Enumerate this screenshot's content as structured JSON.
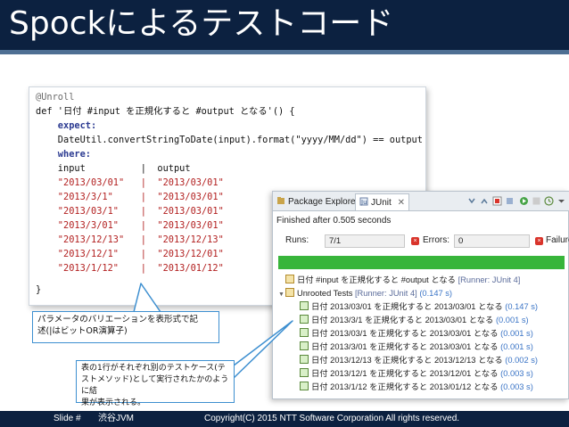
{
  "slide": {
    "title": "Spockによるテストコード"
  },
  "code": {
    "lines": [
      "@Unroll",
      "def '日付 #input を正規化すると #output となる'() {",
      "    expect:",
      "    DateUtil.convertStringToDate(input).format(\"yyyy/MM/dd\") == output",
      "    where:",
      "    input          |  output",
      "    \"2013/03/01\"   |  \"2013/03/01\"",
      "    \"2013/3/1\"     |  \"2013/03/01\"",
      "    \"2013/03/1\"    |  \"2013/03/01\"",
      "    \"2013/3/01\"    |  \"2013/03/01\"",
      "    \"2013/12/13\"   |  \"2013/12/13\"",
      "    \"2013/12/1\"    |  \"2013/12/01\"",
      "    \"2013/1/12\"    |  \"2013/01/12\"",
      "}"
    ]
  },
  "ide": {
    "tabs": [
      "Package Explorer",
      "JUnit"
    ],
    "status": "Finished after 0.505 seconds",
    "runs_label": "Runs:",
    "runs_value": "7/1",
    "errors_label": "Errors:",
    "errors_value": "0",
    "failures_label": "Failures",
    "progress_fraction": 1.0,
    "tree": [
      {
        "text": "日付 #input を正規化すると #output となる",
        "meta": "[Runner: JUnit 4]",
        "time": ""
      },
      {
        "text": "Unrooted Tests",
        "meta": "[Runner: JUnit 4]",
        "time": "(0.147 s)"
      },
      {
        "text": "日付 2013/03/01 を正規化すると 2013/03/01 となる",
        "meta": "",
        "time": "(0.147 s)"
      },
      {
        "text": "日付 2013/3/1 を正規化すると 2013/03/01 となる",
        "meta": "",
        "time": "(0.001 s)"
      },
      {
        "text": "日付 2013/03/1 を正規化すると 2013/03/01 となる",
        "meta": "",
        "time": "(0.001 s)"
      },
      {
        "text": "日付 2013/3/01 を正規化すると 2013/03/01 となる",
        "meta": "",
        "time": "(0.001 s)"
      },
      {
        "text": "日付 2013/12/13 を正規化すると 2013/12/13 となる",
        "meta": "",
        "time": "(0.002 s)"
      },
      {
        "text": "日付 2013/12/1 を正規化すると 2013/12/01 となる",
        "meta": "",
        "time": "(0.003 s)"
      },
      {
        "text": "日付 2013/1/12 を正規化すると 2013/01/12 となる",
        "meta": "",
        "time": "(0.003 s)"
      }
    ]
  },
  "callouts": {
    "first": [
      "パラメータのバリエーションを表形式で記",
      "述(|はビットOR演算子)"
    ],
    "second": [
      "表の1行がそれぞれ別のテストケース(テ",
      "ストメソッド)として実行されたかのように結",
      "果が表示される。"
    ]
  },
  "footer": {
    "slide_label": "Slide #",
    "event": "渋谷JVM",
    "copyright": "Copyright(C) 2015 NTT Software Corporation All rights reserved."
  },
  "colors": {
    "title_bg": "#0c2140",
    "accent_rule": "#4e6f93",
    "callout_border": "#3d8fd0",
    "progress_green": "#38b53a",
    "keyword": "#2b3a91",
    "string": "#b21f1f"
  }
}
